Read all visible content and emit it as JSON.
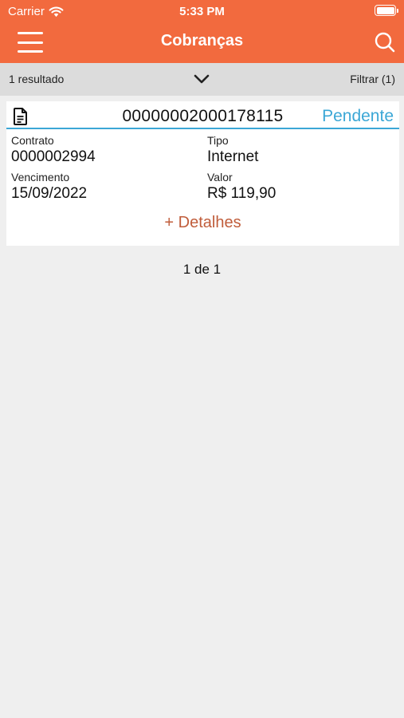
{
  "status_bar": {
    "carrier": "Carrier",
    "time": "5:33 PM"
  },
  "header": {
    "title": "Cobranças",
    "background_color": "#f26a3e",
    "menu_icon": "hamburger-menu-icon",
    "search_icon": "search-icon"
  },
  "filter_bar": {
    "result_count": "1 resultado",
    "expand_icon": "chevron-down-icon",
    "filter_label": "Filtrar (1)"
  },
  "invoice": {
    "icon": "document-icon",
    "number": "00000002000178115",
    "status": "Pendente",
    "status_color": "#3ba7d6",
    "contract_label": "Contrato",
    "contract_value": "0000002994",
    "type_label": "Tipo",
    "type_value": "Internet",
    "due_label": "Vencimento",
    "due_value": "15/09/2022",
    "amount_label": "Valor",
    "amount_value": "R$ 119,90",
    "details_link": "+ Detalhes",
    "details_color": "#c05d3b"
  },
  "pagination": {
    "text": "1 de 1"
  }
}
